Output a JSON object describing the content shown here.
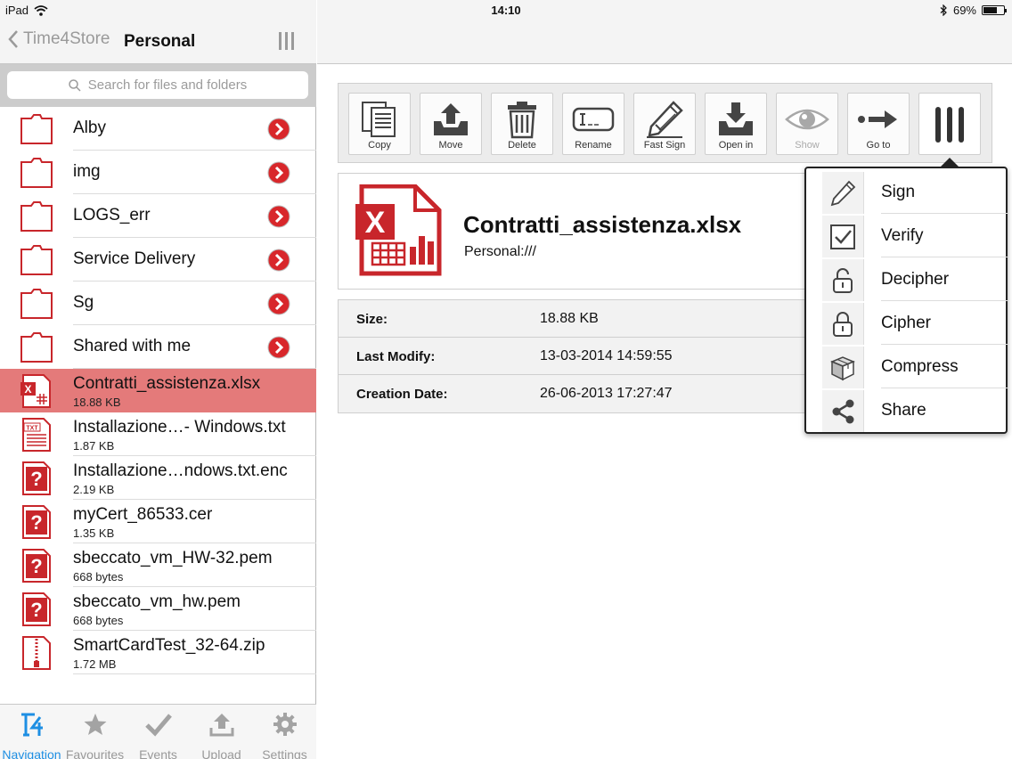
{
  "status": {
    "device": "iPad",
    "time": "14:10",
    "battery": "69%",
    "battery_level": 0.69
  },
  "sidebar": {
    "back_label": "Time4Store",
    "title": "Personal",
    "search_placeholder": "Search for files and folders",
    "folders": [
      {
        "name": "Alby"
      },
      {
        "name": "img"
      },
      {
        "name": "LOGS_err"
      },
      {
        "name": "Service Delivery"
      },
      {
        "name": "Sg"
      },
      {
        "name": "Shared with me"
      }
    ],
    "files": [
      {
        "name": "Contratti_assistenza.xlsx",
        "size": "18.88 KB",
        "icon": "excel-file-icon"
      },
      {
        "name": "Installazione…- Windows.txt",
        "size": "1.87 KB",
        "icon": "txt-file-icon"
      },
      {
        "name": "Installazione…ndows.txt.enc",
        "size": "2.19 KB",
        "icon": "unknown-file-icon"
      },
      {
        "name": "myCert_86533.cer",
        "size": "1.35 KB",
        "icon": "unknown-file-icon"
      },
      {
        "name": "sbeccato_vm_HW-32.pem",
        "size": "668 bytes",
        "icon": "unknown-file-icon"
      },
      {
        "name": "sbeccato_vm_hw.pem",
        "size": "668 bytes",
        "icon": "unknown-file-icon"
      },
      {
        "name": "SmartCardTest_32-64.zip",
        "size": "1.72 MB",
        "icon": "zip-file-icon"
      }
    ],
    "tabs": [
      {
        "label": "Navigation",
        "icon": "t4-logo-icon"
      },
      {
        "label": "Favourites",
        "icon": "star-icon"
      },
      {
        "label": "Events",
        "icon": "checkmark-icon"
      },
      {
        "label": "Upload",
        "icon": "upload-icon"
      },
      {
        "label": "Settings",
        "icon": "gear-icon"
      }
    ]
  },
  "toolbar": {
    "buttons": [
      {
        "label": "Copy",
        "icon": "copy-icon"
      },
      {
        "label": "Move",
        "icon": "move-icon"
      },
      {
        "label": "Delete",
        "icon": "trash-icon"
      },
      {
        "label": "Rename",
        "icon": "rename-icon"
      },
      {
        "label": "Fast Sign",
        "icon": "pencil-icon"
      },
      {
        "label": "Open in",
        "icon": "open-in-icon"
      },
      {
        "label": "Show",
        "icon": "eye-icon",
        "disabled": true
      },
      {
        "label": "Go to",
        "icon": "arrow-right-icon"
      },
      {
        "label": "",
        "icon": "more-icon"
      }
    ]
  },
  "detail": {
    "file_name": "Contratti_assistenza.xlsx",
    "path": "Personal:///",
    "properties": [
      {
        "key": "Size:",
        "value": "18.88 KB"
      },
      {
        "key": "Last Modify:",
        "value": "13-03-2014 14:59:55"
      },
      {
        "key": "Creation Date:",
        "value": "26-06-2013 17:27:47"
      }
    ]
  },
  "popover_menu": {
    "items": [
      {
        "label": "Sign",
        "icon": "pencil-icon"
      },
      {
        "label": "Verify",
        "icon": "checkbox-icon"
      },
      {
        "label": "Decipher",
        "icon": "unlock-icon"
      },
      {
        "label": "Cipher",
        "icon": "lock-icon"
      },
      {
        "label": "Compress",
        "icon": "box-icon"
      },
      {
        "label": "Share",
        "icon": "share-icon"
      }
    ]
  },
  "colors": {
    "brand_red": "#c8262b",
    "selection": "#e47a7a",
    "tab_active": "#1e8fe3"
  }
}
